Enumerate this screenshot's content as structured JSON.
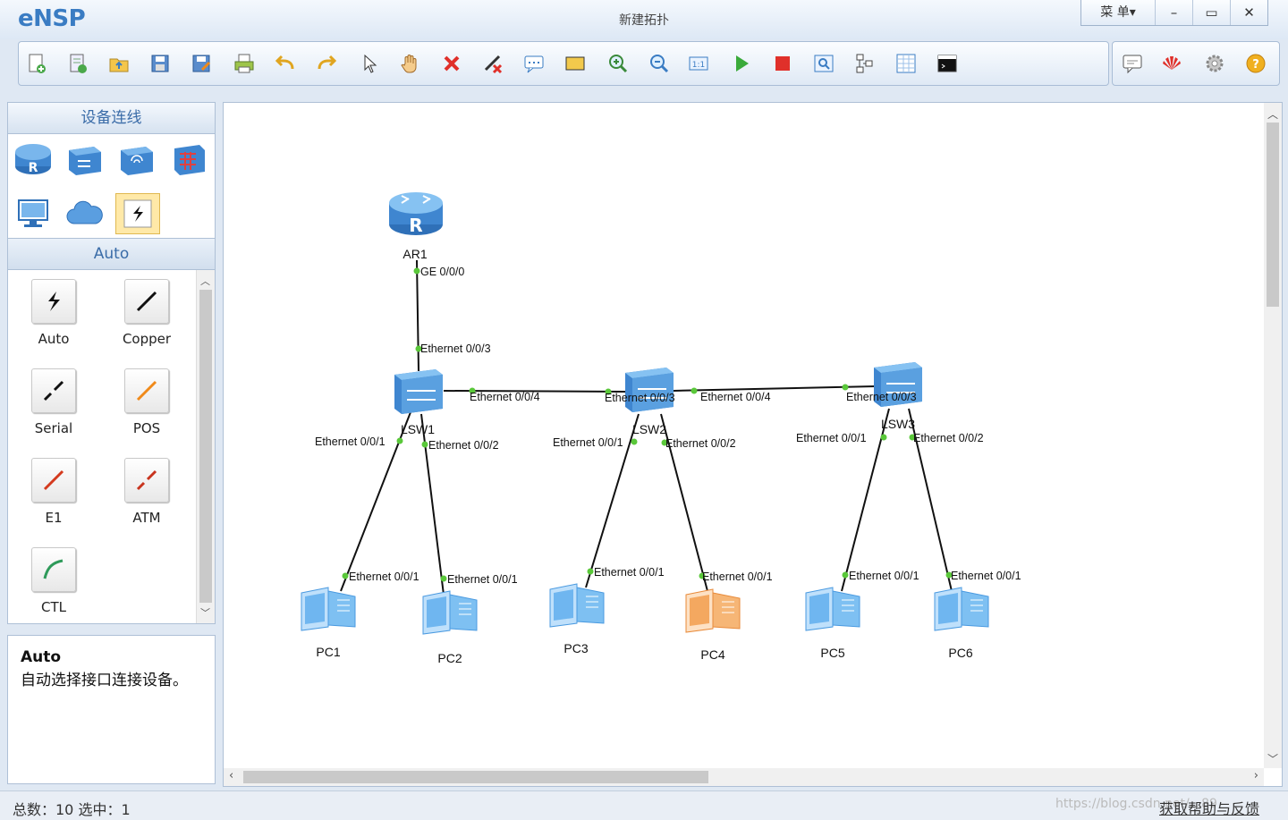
{
  "app": {
    "logo": "eNSP",
    "title": "新建拓扑",
    "menu": "菜 单▾",
    "min": "–",
    "max": "▭",
    "close": "✕"
  },
  "toolbar": {
    "icons": [
      "new-topology-icon",
      "new-from-template-icon",
      "open-icon",
      "save-icon",
      "save-as-icon",
      "print-icon",
      "undo-icon",
      "redo-icon",
      "select-icon",
      "pan-icon",
      "delete-icon",
      "delete-link-icon",
      "text-icon",
      "rectangle-icon",
      "zoom-in-icon",
      "zoom-out-icon",
      "fit-icon",
      "start-icon",
      "stop-icon",
      "capture-icon",
      "topology-icon",
      "grid-icon",
      "console-icon"
    ]
  },
  "toolbar_right": {
    "icons": [
      "chat-icon",
      "huawei-icon",
      "settings-icon",
      "help-icon"
    ]
  },
  "left": {
    "device_header": "设备连线",
    "devices": [
      "router-icon",
      "switch-icon",
      "wireless-icon",
      "firewall-icon",
      "pc-icon",
      "cloud-icon",
      "cable-icon"
    ],
    "cable_header": "Auto",
    "cables": [
      {
        "label": "Auto",
        "icon": "auto-cable-icon",
        "color": "#111"
      },
      {
        "label": "Copper",
        "icon": "copper-cable-icon",
        "color": "#111"
      },
      {
        "label": "Serial",
        "icon": "serial-cable-icon",
        "color": "#111"
      },
      {
        "label": "POS",
        "icon": "pos-cable-icon",
        "color": "#f08a1a"
      },
      {
        "label": "E1",
        "icon": "e1-cable-icon",
        "color": "#d43a1e"
      },
      {
        "label": "ATM",
        "icon": "atm-cable-icon",
        "color": "#c8341e"
      },
      {
        "label": "CTL",
        "icon": "ctl-cable-icon",
        "color": "#2e9a5a"
      }
    ],
    "desc_title": "Auto",
    "desc_text": "自动选择接口连接设备。"
  },
  "topology": {
    "nodes": [
      {
        "id": "AR1",
        "label": "AR1",
        "type": "router"
      },
      {
        "id": "LSW1",
        "label": "LSW1",
        "type": "switch"
      },
      {
        "id": "LSW2",
        "label": "LSW2",
        "type": "switch"
      },
      {
        "id": "LSW3",
        "label": "LSW3",
        "type": "switch"
      },
      {
        "id": "PC1",
        "label": "PC1",
        "type": "pc"
      },
      {
        "id": "PC2",
        "label": "PC2",
        "type": "pc"
      },
      {
        "id": "PC3",
        "label": "PC3",
        "type": "pc"
      },
      {
        "id": "PC4",
        "label": "PC4",
        "type": "pc-orange"
      },
      {
        "id": "PC5",
        "label": "PC5",
        "type": "pc"
      },
      {
        "id": "PC6",
        "label": "PC6",
        "type": "pc"
      }
    ],
    "port_labels": [
      "GE 0/0/0",
      "Ethernet 0/0/3",
      "Ethernet 0/0/4",
      "Ethernet 0/0/3",
      "Ethernet 0/0/4",
      "Ethernet 0/0/3",
      "Ethernet 0/0/1",
      "Ethernet 0/0/2",
      "Ethernet 0/0/1",
      "Ethernet 0/0/2",
      "Ethernet 0/0/1",
      "Ethernet 0/0/2",
      "Ethernet 0/0/1",
      "Ethernet 0/0/1",
      "Ethernet 0/0/1",
      "Ethernet 0/0/1",
      "Ethernet 0/0/1",
      "Ethernet 0/0/1"
    ]
  },
  "status": {
    "text": "总数：10  选中：1",
    "help": "获取帮助与反馈",
    "watermark": "https://blog.csdn.net/...89"
  }
}
